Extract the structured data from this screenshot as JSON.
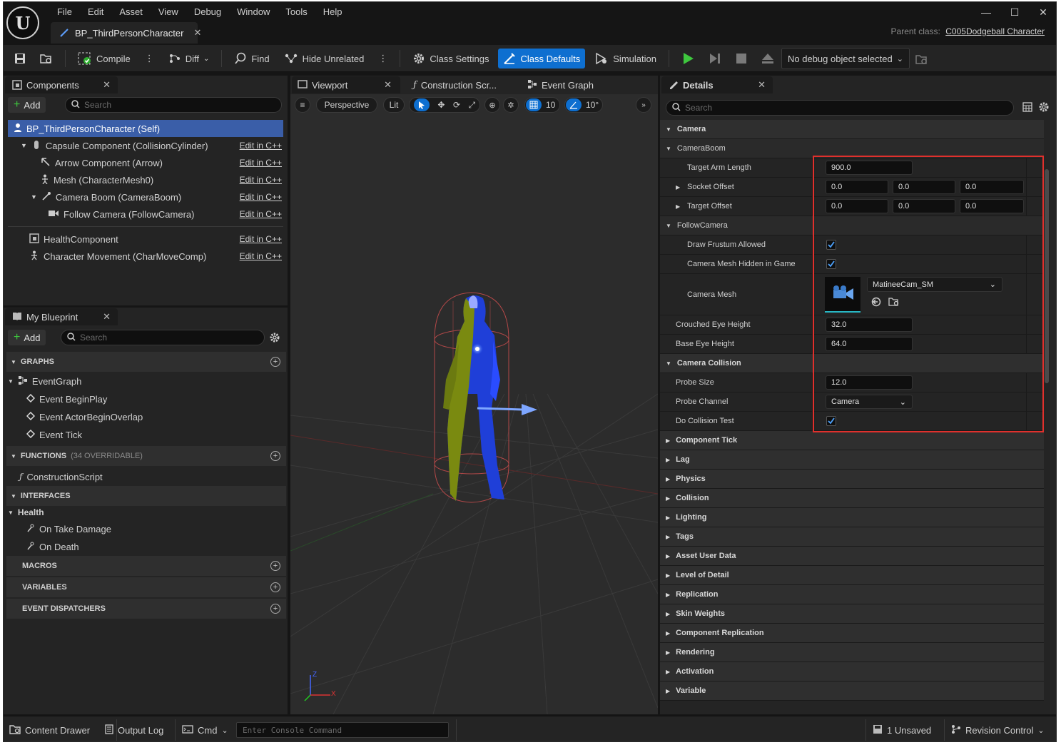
{
  "app": {
    "logo": "U",
    "menu": [
      "File",
      "Edit",
      "Asset",
      "View",
      "Debug",
      "Window",
      "Tools",
      "Help"
    ],
    "doc_tab": "BP_ThirdPersonCharacter",
    "parent_label": "Parent class:",
    "parent_value": "C005Dodgeball Character"
  },
  "toolbar": {
    "compile": "Compile",
    "diff": "Diff",
    "find": "Find",
    "hide_unrelated": "Hide Unrelated",
    "class_settings": "Class Settings",
    "class_defaults": "Class Defaults",
    "simulation": "Simulation",
    "debug_select": "No debug object selected"
  },
  "components": {
    "tab": "Components",
    "add": "Add",
    "search_placeholder": "Search",
    "edit_label": "Edit in C++",
    "items": [
      {
        "label": "BP_ThirdPersonCharacter (Self)",
        "icon": "person-icon"
      },
      {
        "label": "Capsule Component (CollisionCylinder)",
        "icon": "capsule-icon"
      },
      {
        "label": "Arrow Component (Arrow)",
        "icon": "arrow-icon"
      },
      {
        "label": "Mesh (CharacterMesh0)",
        "icon": "skeleton-icon"
      },
      {
        "label": "Camera Boom (CameraBoom)",
        "icon": "camera-boom-icon"
      },
      {
        "label": "Follow Camera (FollowCamera)",
        "icon": "camera-icon"
      },
      {
        "label": "HealthComponent",
        "icon": "component-icon"
      },
      {
        "label": "Character Movement (CharMoveComp)",
        "icon": "movement-icon"
      }
    ]
  },
  "my_blueprint": {
    "tab": "My Blueprint",
    "add": "Add",
    "search_placeholder": "Search",
    "graphs": "GRAPHS",
    "event_graph": "EventGraph",
    "events": [
      "Event BeginPlay",
      "Event ActorBeginOverlap",
      "Event Tick"
    ],
    "functions": "FUNCTIONS",
    "functions_note": "(34 OVERRIDABLE)",
    "construction_script": "ConstructionScript",
    "interfaces": "INTERFACES",
    "interface_name": "Health",
    "interface_items": [
      "On Take Damage",
      "On Death"
    ],
    "macros": "MACROS",
    "variables": "VARIABLES",
    "dispatchers": "EVENT DISPATCHERS"
  },
  "viewport": {
    "tabs": [
      "Viewport",
      "Construction Scr...",
      "Event Graph"
    ],
    "perspective": "Perspective",
    "lit": "Lit",
    "grid_snap": "10",
    "angle_snap": "10°",
    "axis_x": "X",
    "axis_z": "Z"
  },
  "details": {
    "tab": "Details",
    "search_placeholder": "Search",
    "camera": "Camera",
    "camera_boom": "CameraBoom",
    "target_arm_length_label": "Target Arm Length",
    "target_arm_length": "900.0",
    "socket_offset_label": "Socket Offset",
    "socket_offset": [
      "0.0",
      "0.0",
      "0.0"
    ],
    "target_offset_label": "Target Offset",
    "target_offset": [
      "0.0",
      "0.0",
      "0.0"
    ],
    "follow_camera": "FollowCamera",
    "draw_frustum_label": "Draw Frustum Allowed",
    "mesh_hidden_label": "Camera Mesh Hidden in Game",
    "camera_mesh_label": "Camera Mesh",
    "camera_mesh_value": "MatineeCam_SM",
    "crouched_eye_label": "Crouched Eye Height",
    "crouched_eye": "32.0",
    "base_eye_label": "Base Eye Height",
    "base_eye": "64.0",
    "camera_collision": "Camera Collision",
    "probe_size_label": "Probe Size",
    "probe_size": "12.0",
    "probe_channel_label": "Probe Channel",
    "probe_channel": "Camera",
    "do_collision_label": "Do Collision Test",
    "categories": [
      "Component Tick",
      "Lag",
      "Physics",
      "Collision",
      "Lighting",
      "Tags",
      "Asset User Data",
      "Level of Detail",
      "Replication",
      "Skin Weights",
      "Component Replication",
      "Rendering",
      "Activation",
      "Variable"
    ],
    "highlight_color": "#e0302c"
  },
  "status": {
    "content_drawer": "Content Drawer",
    "output_log": "Output Log",
    "cmd": "Cmd",
    "console_placeholder": "Enter Console Command",
    "unsaved": "1 Unsaved",
    "revision": "Revision Control"
  }
}
